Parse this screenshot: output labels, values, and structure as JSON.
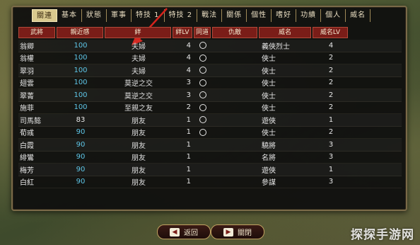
{
  "tabs": [
    "關連",
    "基本",
    "狀態",
    "軍事",
    "特技 1",
    "特技 2",
    "戰法",
    "關係",
    "個性",
    "嗜好",
    "功績",
    "個人",
    "威名"
  ],
  "columns": [
    "武將",
    "親近感",
    "絆",
    "絆LV",
    "同道",
    "仇敵",
    "威名",
    "威名LV"
  ],
  "rows": [
    {
      "name": "翁卿",
      "aff": "100",
      "rel": "夫婦",
      "rlv": "4",
      "del": true,
      "fame": "義俠烈士",
      "flv": "4"
    },
    {
      "name": "翁權",
      "aff": "100",
      "rel": "夫婦",
      "rlv": "4",
      "del": true,
      "fame": "俠士",
      "flv": "2"
    },
    {
      "name": "翠羽",
      "aff": "100",
      "rel": "夫婦",
      "rlv": "4",
      "del": true,
      "fame": "俠士",
      "flv": "2"
    },
    {
      "name": "翅雲",
      "aff": "100",
      "rel": "莫逆之交",
      "rlv": "3",
      "del": true,
      "fame": "俠士",
      "flv": "2"
    },
    {
      "name": "翠菁",
      "aff": "100",
      "rel": "莫逆之交",
      "rlv": "3",
      "del": true,
      "fame": "俠士",
      "flv": "2"
    },
    {
      "name": "施菲",
      "aff": "100",
      "rel": "至親之友",
      "rlv": "2",
      "del": true,
      "fame": "俠士",
      "flv": "2"
    },
    {
      "name": "司馬懿",
      "aff": "83",
      "rel": "朋友",
      "rlv": "1",
      "del": true,
      "fame": "遊俠",
      "flv": "1"
    },
    {
      "name": "荀彧",
      "aff": "90",
      "rel": "朋友",
      "rlv": "1",
      "del": true,
      "fame": "俠士",
      "flv": "2"
    },
    {
      "name": "白霞",
      "aff": "90",
      "rel": "朋友",
      "rlv": "1",
      "del": false,
      "fame": "驍將",
      "flv": "3"
    },
    {
      "name": "緋鸞",
      "aff": "90",
      "rel": "朋友",
      "rlv": "1",
      "del": false,
      "fame": "名將",
      "flv": "3"
    },
    {
      "name": "梅芳",
      "aff": "90",
      "rel": "朋友",
      "rlv": "1",
      "del": false,
      "fame": "遊俠",
      "flv": "1"
    },
    {
      "name": "白紅",
      "aff": "90",
      "rel": "朋友",
      "rlv": "1",
      "del": false,
      "fame": "參謀",
      "flv": "3"
    }
  ],
  "buttons": {
    "back": "返回",
    "close": "關閉"
  },
  "icons": {
    "back": "arrow-left-icon",
    "close": "door-close-icon"
  },
  "watermark": "探探手游网",
  "colors": {
    "accent_red": "#7a1d18",
    "affinity_blue": "#5ec6e8",
    "annotation_arrow": "#d4231c"
  }
}
